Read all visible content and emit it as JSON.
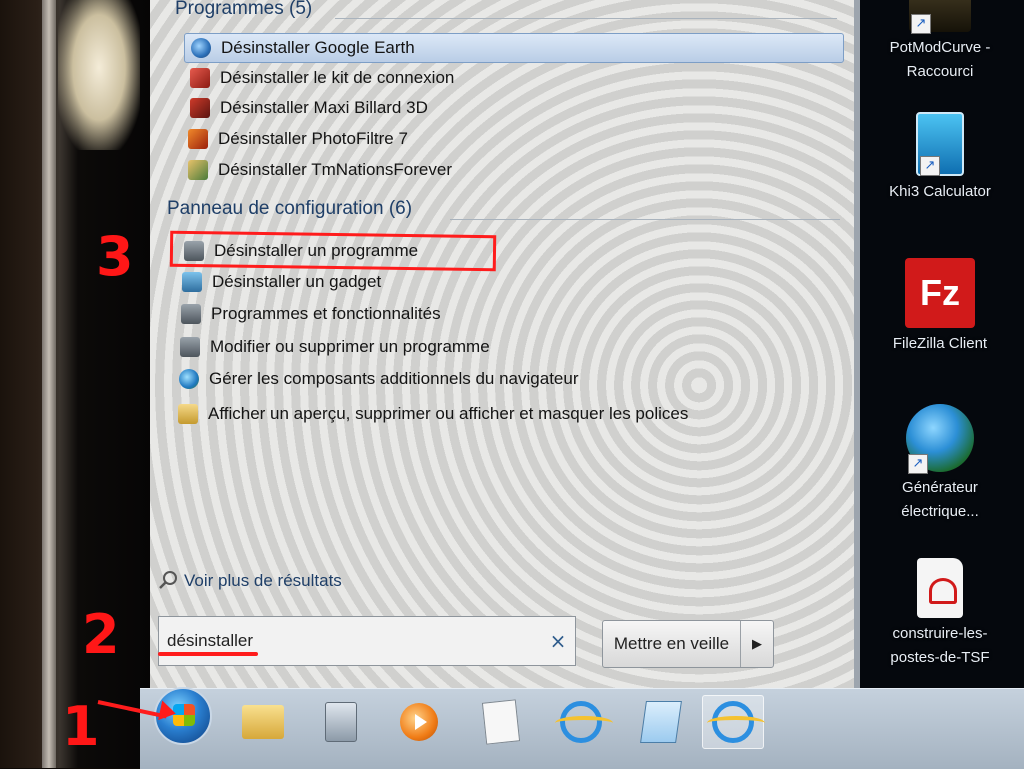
{
  "start_menu": {
    "programs_header": "Programmes (5)",
    "programs": [
      {
        "label": "Désinstaller Google Earth",
        "icon": "google-earth-icon",
        "selected": true
      },
      {
        "label": "Désinstaller le kit de connexion",
        "icon": "uninstall-icon",
        "selected": false
      },
      {
        "label": "Désinstaller Maxi Billard 3D",
        "icon": "billiard-icon",
        "selected": false
      },
      {
        "label": "Désinstaller PhotoFiltre 7",
        "icon": "photofiltre-icon",
        "selected": false
      },
      {
        "label": "Désinstaller TmNationsForever",
        "icon": "installer-icon",
        "selected": false
      }
    ],
    "control_panel_header": "Panneau de configuration (6)",
    "control_panel": [
      {
        "label": "Désinstaller un programme",
        "icon": "programs-icon"
      },
      {
        "label": "Désinstaller un gadget",
        "icon": "gadget-icon"
      },
      {
        "label": "Programmes et fonctionnalités",
        "icon": "programs-icon"
      },
      {
        "label": "Modifier ou supprimer un programme",
        "icon": "programs-icon"
      },
      {
        "label": "Gérer les composants additionnels du navigateur",
        "icon": "internet-options-icon"
      },
      {
        "label": "Afficher un aperçu, supprimer ou afficher et masquer les polices",
        "icon": "fonts-icon"
      }
    ],
    "more_results": "Voir plus de résultats",
    "search_value": "désinstaller",
    "clear_symbol": "×",
    "shutdown_label": "Mettre en veille",
    "shutdown_arrow": "▶"
  },
  "desktop": {
    "icons": [
      {
        "label": "PotModCurve - Raccourci",
        "icon": "potmodcurve-icon",
        "shortcut_symbol": "↗"
      },
      {
        "label": "Khi3 Calculator",
        "icon": "calculator-icon",
        "shortcut_symbol": "↗"
      },
      {
        "label": "FileZilla Client",
        "icon": "filezilla-icon",
        "glyph": "Fz",
        "shortcut_symbol": "↗"
      },
      {
        "label": "Générateur électrique...",
        "icon": "globe-icon",
        "shortcut_symbol": "↗"
      },
      {
        "label": "construire-les-postes-de-TSF",
        "icon": "pdf-icon",
        "shortcut_symbol": ""
      }
    ]
  },
  "taskbar": {
    "buttons": [
      {
        "name": "explorer",
        "icon": "folder-icon"
      },
      {
        "name": "calculator",
        "icon": "calculator-icon"
      },
      {
        "name": "media-player",
        "icon": "media-player-icon"
      },
      {
        "name": "wordpad",
        "icon": "wordpad-icon"
      },
      {
        "name": "internet-explorer",
        "icon": "internet-explorer-icon"
      },
      {
        "name": "notepad",
        "icon": "notepad-icon"
      },
      {
        "name": "internet-explorer-active",
        "icon": "internet-explorer-icon",
        "active": true
      }
    ]
  },
  "annotations": {
    "step1": "1",
    "step2": "2",
    "step3": "3",
    "color": "#ff1c1c"
  }
}
